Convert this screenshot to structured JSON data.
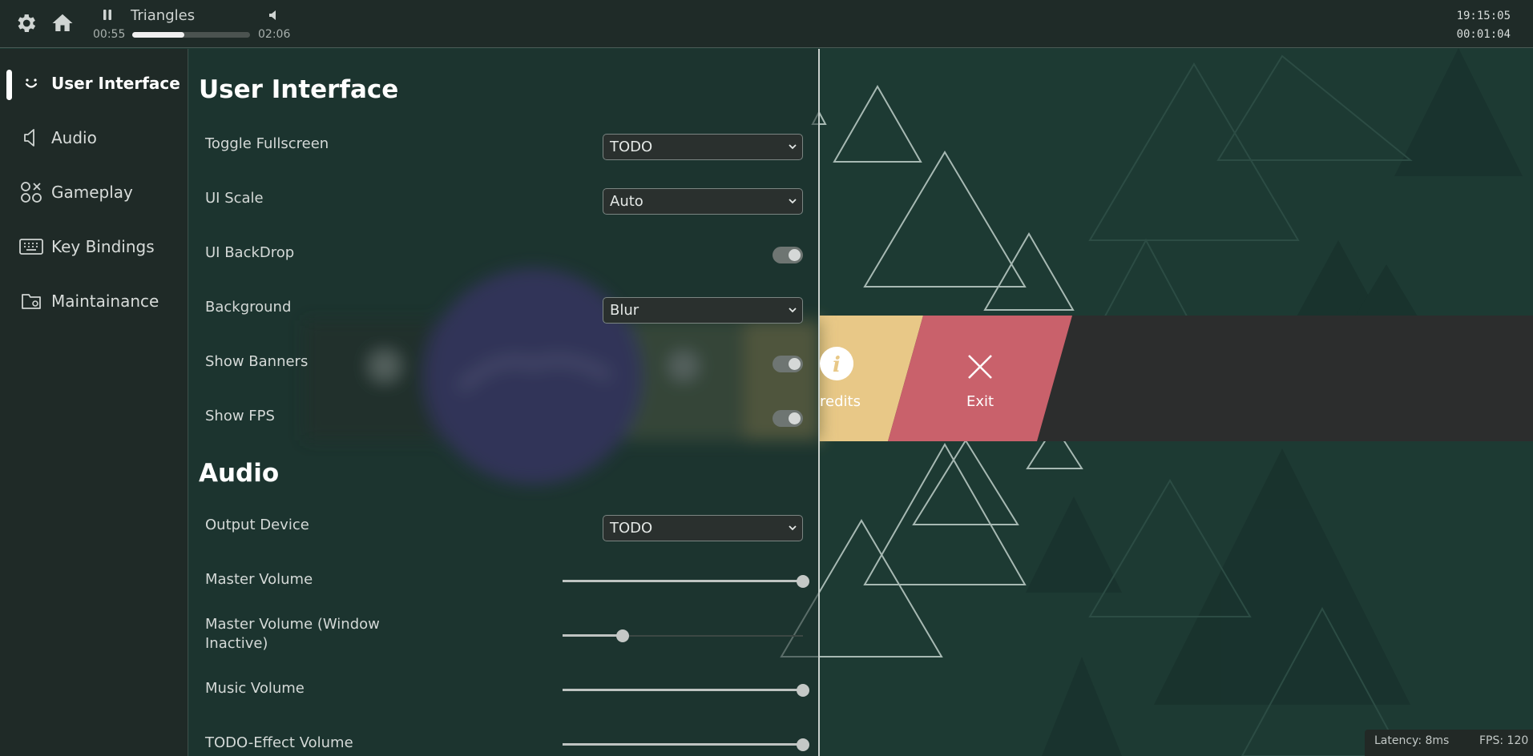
{
  "topbar": {
    "settings_icon": "gear-icon",
    "home_icon": "home-icon",
    "pause_icon": "pause-icon",
    "volume_icon": "volume-icon",
    "track_title": "Triangles",
    "time_current": "00:55",
    "time_total": "02:06",
    "progress_fraction": 0.44,
    "clock_time": "19:15:05",
    "clock_elapsed": "00:01:04"
  },
  "sidebar": {
    "items": [
      {
        "label": "User Interface",
        "icon": "smiley-icon",
        "active": true
      },
      {
        "label": "Audio",
        "icon": "speaker-icon",
        "active": false
      },
      {
        "label": "Gameplay",
        "icon": "gameplay-icon",
        "active": false
      },
      {
        "label": "Key Bindings",
        "icon": "keyboard-icon",
        "active": false
      },
      {
        "label": "Maintainance",
        "icon": "folder-gear-icon",
        "active": false
      }
    ]
  },
  "ui_section": {
    "title": "User Interface",
    "toggle_fullscreen": {
      "label": "Toggle Fullscreen",
      "value": "TODO"
    },
    "ui_scale": {
      "label": "UI Scale",
      "value": "Auto"
    },
    "ui_backdrop": {
      "label": "UI BackDrop",
      "on": true
    },
    "background": {
      "label": "Background",
      "value": "Blur"
    },
    "show_banners": {
      "label": "Show Banners",
      "on": true
    },
    "show_fps": {
      "label": "Show FPS",
      "on": true
    }
  },
  "audio_section": {
    "title": "Audio",
    "output_device": {
      "label": "Output Device",
      "value": "TODO"
    },
    "master_volume": {
      "label": "Master Volume",
      "level": 1.0
    },
    "master_volume_inactive": {
      "label_line1": "Master Volume (Window",
      "label_line2": "Inactive)",
      "level": 0.25
    },
    "music_volume": {
      "label": "Music Volume",
      "level": 1.0
    },
    "effect_volume": {
      "label": "TODO-Effect Volume",
      "level": 1.0
    }
  },
  "menu": {
    "credits_label": "redits",
    "credits_icon": "info-icon",
    "exit_label": "Exit",
    "exit_icon": "close-icon",
    "credits_color": "#e8c887",
    "exit_color": "#c9616b"
  },
  "status": {
    "latency": "Latency: 8ms",
    "fps": "FPS: 120"
  },
  "colors": {
    "background": "#1e3a33",
    "topbar": "#1f2b28",
    "sidebar": "#1f2a27",
    "logo_purple": "#4e3b8e"
  }
}
